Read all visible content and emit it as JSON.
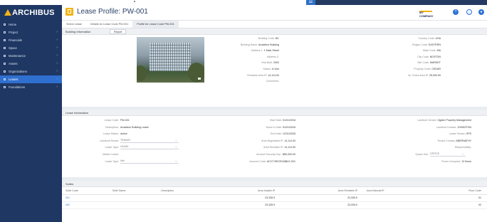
{
  "app": {
    "logo": "ARCHIBUS",
    "title": "Lease Profile: PW-001",
    "company": "MY COMPANY"
  },
  "sidebar": {
    "items": [
      {
        "label": "Home",
        "icon": "home-icon"
      },
      {
        "label": "Project",
        "icon": "project-icon"
      },
      {
        "label": "Financials",
        "icon": "financials-icon"
      },
      {
        "label": "Space",
        "icon": "space-icon"
      },
      {
        "label": "Maintenance",
        "icon": "wrench-icon"
      },
      {
        "label": "Assets",
        "icon": "assets-icon"
      },
      {
        "label": "Organizations",
        "icon": "org-icon"
      },
      {
        "label": "Leases",
        "icon": "leases-icon"
      },
      {
        "label": "Foundations",
        "icon": "foundations-icon"
      }
    ]
  },
  "crumbs": [
    "Select Lease",
    "Details for Lease Code PW-001",
    "Profile for Lease Code PW-001"
  ],
  "building": {
    "heading": "Building Information",
    "report": "Report",
    "fields": [
      {
        "label": "Building Code:",
        "value": "BC"
      },
      {
        "label": "Building Name:",
        "value": "Arcadium Building"
      },
      {
        "label": "Address 1:",
        "value": "1 Main Street"
      },
      {
        "label": "Address 2:",
        "value": ""
      },
      {
        "label": "Year Built:",
        "value": "2002"
      },
      {
        "label": "Status:",
        "value": "In Use"
      },
      {
        "label": "Rentable Area ft²:",
        "value": "14,114.00"
      },
      {
        "label": "Comments:",
        "value": ""
      }
    ],
    "fields_right": [
      {
        "label": "Country Code:",
        "value": "USA"
      },
      {
        "label": "Region Code:",
        "value": "EASTERN"
      },
      {
        "label": "State Code:",
        "value": "MA"
      },
      {
        "label": "City Code:",
        "value": "BOSTON"
      },
      {
        "label": "Site Code:",
        "value": "MARKET"
      },
      {
        "label": "Property Code:",
        "value": "CEDAR"
      },
      {
        "label": "Int. Gross Area ft²:",
        "value": "25,000.00"
      }
    ]
  },
  "lease": {
    "heading": "Lease Information",
    "col1": [
      {
        "label": "Lease Code:",
        "value": "PW-001"
      },
      {
        "label": "Description:",
        "value": "Arcadium Building Lease"
      },
      {
        "label": "Lease Status:",
        "value": "Active"
      },
      {
        "label": "Landlord/Tenant:",
        "value": "TENANT"
      },
      {
        "label": "Lease Type:",
        "value": "LEASE"
      },
      {
        "label": "Master Lease:",
        "value": ""
      },
      {
        "label": "Lease Type:",
        "value": "Net"
      }
    ],
    "col2": [
      {
        "label": "Start Date:",
        "value": "01/01/2016"
      },
      {
        "label": "Move In Date:",
        "value": "01/01/2016"
      },
      {
        "label": "End Date:",
        "value": "12/31/2025"
      },
      {
        "label": "Area Negotiated ft²:",
        "value": "14,114.00"
      },
      {
        "label": "Area Rentable ft²:",
        "value": "14,114.00"
      },
      {
        "label": "Amount Security Dep.:",
        "value": "$50,000.00"
      },
      {
        "label": "Account Code:",
        "value": "ACCT-RECEIVABLE-001"
      }
    ],
    "col3": [
      {
        "label": "Landlord Vendor:",
        "value": "Ogden Property Management"
      },
      {
        "label": "Landlord Contact:",
        "value": "JOHNSTON"
      },
      {
        "label": "Lease Tenant:",
        "value": "OPS"
      },
      {
        "label": "Tenant Contact:",
        "value": "ABERNATHY"
      },
      {
        "label": "Responsibility:",
        "value": ""
      },
      {
        "label": "Space Use:",
        "value": "OFFICE"
      },
      {
        "label": "Floors Occupied:",
        "value": "12 floors"
      }
    ]
  },
  "suites": {
    "heading": "Suites",
    "columns": [
      "Suite Code",
      "Suite Name",
      "Description",
      "Area Usable ft²",
      "Area Rentable ft²",
      "Area Manual ft²",
      "Floor Code"
    ],
    "rows": [
      [
        "001",
        "",
        "",
        "23,335.9",
        "23,335.9",
        "",
        "01"
      ],
      [
        "002",
        "",
        "",
        "23,335.9",
        "23,335.9",
        "",
        "02"
      ]
    ]
  }
}
